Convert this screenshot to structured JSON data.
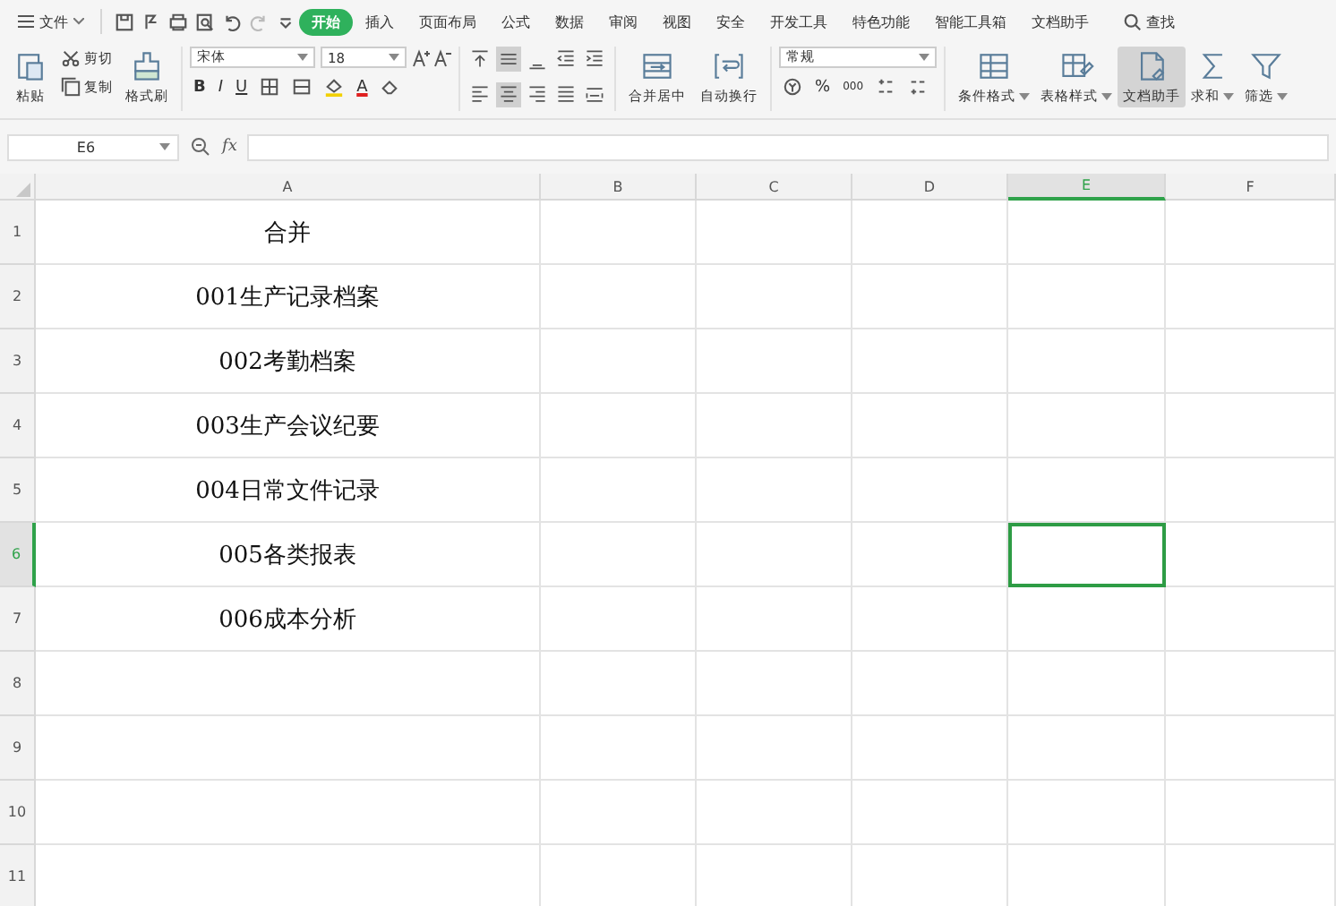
{
  "menu": {
    "file": "文件",
    "tabs": [
      {
        "label": "开始",
        "selected": true
      },
      {
        "label": "插入",
        "selected": false
      },
      {
        "label": "页面布局",
        "selected": false
      },
      {
        "label": "公式",
        "selected": false
      },
      {
        "label": "数据",
        "selected": false
      },
      {
        "label": "审阅",
        "selected": false
      },
      {
        "label": "视图",
        "selected": false
      },
      {
        "label": "安全",
        "selected": false
      },
      {
        "label": "开发工具",
        "selected": false
      },
      {
        "label": "特色功能",
        "selected": false
      },
      {
        "label": "智能工具箱",
        "selected": false
      },
      {
        "label": "文档助手",
        "selected": false
      }
    ],
    "search": "查找"
  },
  "ribbon": {
    "paste": "粘贴",
    "cut": "剪切",
    "copy": "复制",
    "format_painter": "格式刷",
    "font": {
      "name": "宋体",
      "size": "18",
      "bold": "B",
      "italic": "I",
      "underline": "U",
      "color_letter": "A"
    },
    "alignment": [
      {
        "kind": "top",
        "selected": false
      },
      {
        "kind": "middle",
        "selected": true
      },
      {
        "kind": "bottom",
        "selected": false
      },
      {
        "kind": "outdent",
        "selected": false
      },
      {
        "kind": "indent",
        "selected": false
      },
      {
        "kind": "left",
        "selected": false
      },
      {
        "kind": "center",
        "selected": true
      },
      {
        "kind": "right",
        "selected": false
      },
      {
        "kind": "justify",
        "selected": false
      },
      {
        "kind": "distributed",
        "selected": false
      }
    ],
    "merge": "合并居中",
    "wrap": "自动换行",
    "number_format": "常规",
    "percent": "%",
    "thousands": "000",
    "large_buttons": [
      {
        "kind": "conditional",
        "label": "条件格式",
        "selected": false,
        "dropdown": true
      },
      {
        "kind": "table_style",
        "label": "表格样式",
        "selected": false,
        "dropdown": true
      },
      {
        "kind": "assistant",
        "label": "文档助手",
        "selected": true,
        "dropdown": false
      },
      {
        "kind": "sum",
        "label": "求和",
        "selected": false,
        "dropdown": true
      },
      {
        "kind": "filter",
        "label": "筛选",
        "selected": false,
        "dropdown": true
      }
    ]
  },
  "formula_bar": {
    "cell_ref": "E6",
    "fx": "fx"
  },
  "sheet": {
    "columns": [
      {
        "label": "A",
        "selected": false
      },
      {
        "label": "B",
        "selected": false
      },
      {
        "label": "C",
        "selected": false
      },
      {
        "label": "D",
        "selected": false
      },
      {
        "label": "E",
        "selected": true
      },
      {
        "label": "F",
        "selected": false
      }
    ],
    "rows": [
      {
        "label": "1",
        "selected": false,
        "cells": [
          "合并"
        ]
      },
      {
        "label": "2",
        "selected": false,
        "cells": [
          "001生产记录档案"
        ]
      },
      {
        "label": "3",
        "selected": false,
        "cells": [
          "002考勤档案"
        ]
      },
      {
        "label": "4",
        "selected": false,
        "cells": [
          "003生产会议纪要"
        ]
      },
      {
        "label": "5",
        "selected": false,
        "cells": [
          "004日常文件记录"
        ]
      },
      {
        "label": "6",
        "selected": true,
        "cells": [
          "005各类报表"
        ]
      },
      {
        "label": "7",
        "selected": false,
        "cells": [
          "006成本分析"
        ]
      },
      {
        "label": "8",
        "selected": false,
        "cells": []
      },
      {
        "label": "9",
        "selected": false,
        "cells": []
      },
      {
        "label": "10",
        "selected": false,
        "cells": []
      },
      {
        "label": "11",
        "selected": false,
        "cells": []
      }
    ]
  }
}
